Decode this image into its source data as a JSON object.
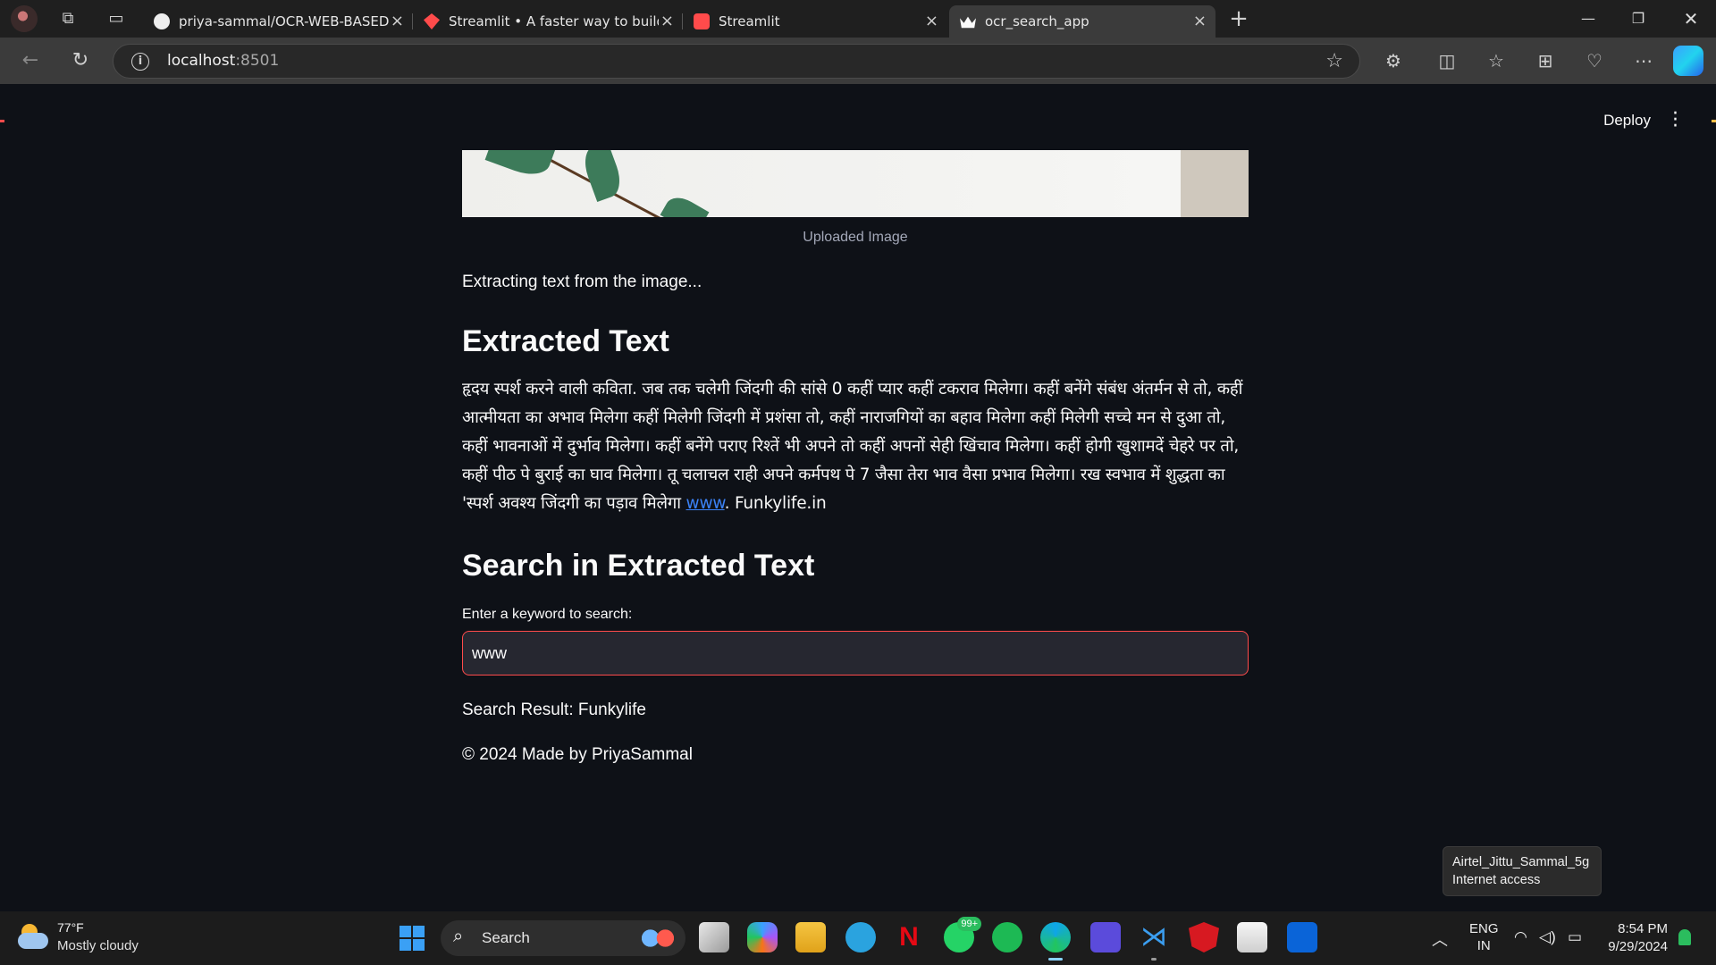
{
  "browser": {
    "tabs": [
      {
        "title": "priya-sammal/OCR-WEB-BASED-/",
        "favicon": "github-icon"
      },
      {
        "title": "Streamlit • A faster way to build a",
        "favicon": "streamlit-icon"
      },
      {
        "title": "Streamlit",
        "favicon": "streamlit-icon"
      },
      {
        "title": "ocr_search_app",
        "favicon": "streamlit-crown-icon",
        "active": true
      }
    ],
    "url_host": "localhost",
    "url_port": ":8501"
  },
  "app": {
    "deploy_label": "Deploy",
    "image_caption": "Uploaded Image",
    "status_text": "Extracting text from the image...",
    "extracted_heading": "Extracted Text",
    "extracted_text": "हृदय स्पर्श करने वाली कविता. जब तक चलेगी जिंदगी की सांसे 0 कहीं प्यार कहीं टकराव मिलेगा। कहीं बनेंगे संबंध अंतर्मन से तो, कहीं आत्मीयता का अभाव मिलेगा कहीं मिलेगी जिंदगी में प्रशंसा तो, कहीं नाराजगियों का बहाव मिलेगा कहीं मिलेगी सच्चे मन से दुआ तो, कहीं भावनाओं में दुर्भाव मिलेगा। कहीं बनेंगे पराए रिश्तें भी अपने तो कहीं अपनों सेही खिंचाव मिलेगा। कहीं होगी खुशामदें चेहरे पर तो, कहीं पीठ पे बुराई का घाव मिलेगा। तू चलाचल राही अपने कर्मपथ पे 7 जैसा तेरा भाव वैसा प्रभाव मिलेगा। रख स्वभाव में शुद्धता का 'स्पर्श अवश्य जिंदगी का पड़ाव मिलेगा ",
    "extracted_link": "www",
    "extracted_tail": ". Funkylife.in",
    "search_heading": "Search in Extracted Text",
    "search_label": "Enter a keyword to search:",
    "search_value": "www",
    "search_result": "Search Result: Funkylife",
    "footer": "© 2024 Made by PriyaSammal",
    "accent_color": "#ff4b4b"
  },
  "tooltip": {
    "network": "Airtel_Jittu_Sammal_5g",
    "status": "Internet access"
  },
  "taskbar": {
    "weather_temp": "77°F",
    "weather_desc": "Mostly cloudy",
    "search_label": "Search",
    "whatsapp_badge": "99+",
    "lang_line1": "ENG",
    "lang_line2": "IN",
    "time": "8:54 PM",
    "date": "9/29/2024"
  }
}
